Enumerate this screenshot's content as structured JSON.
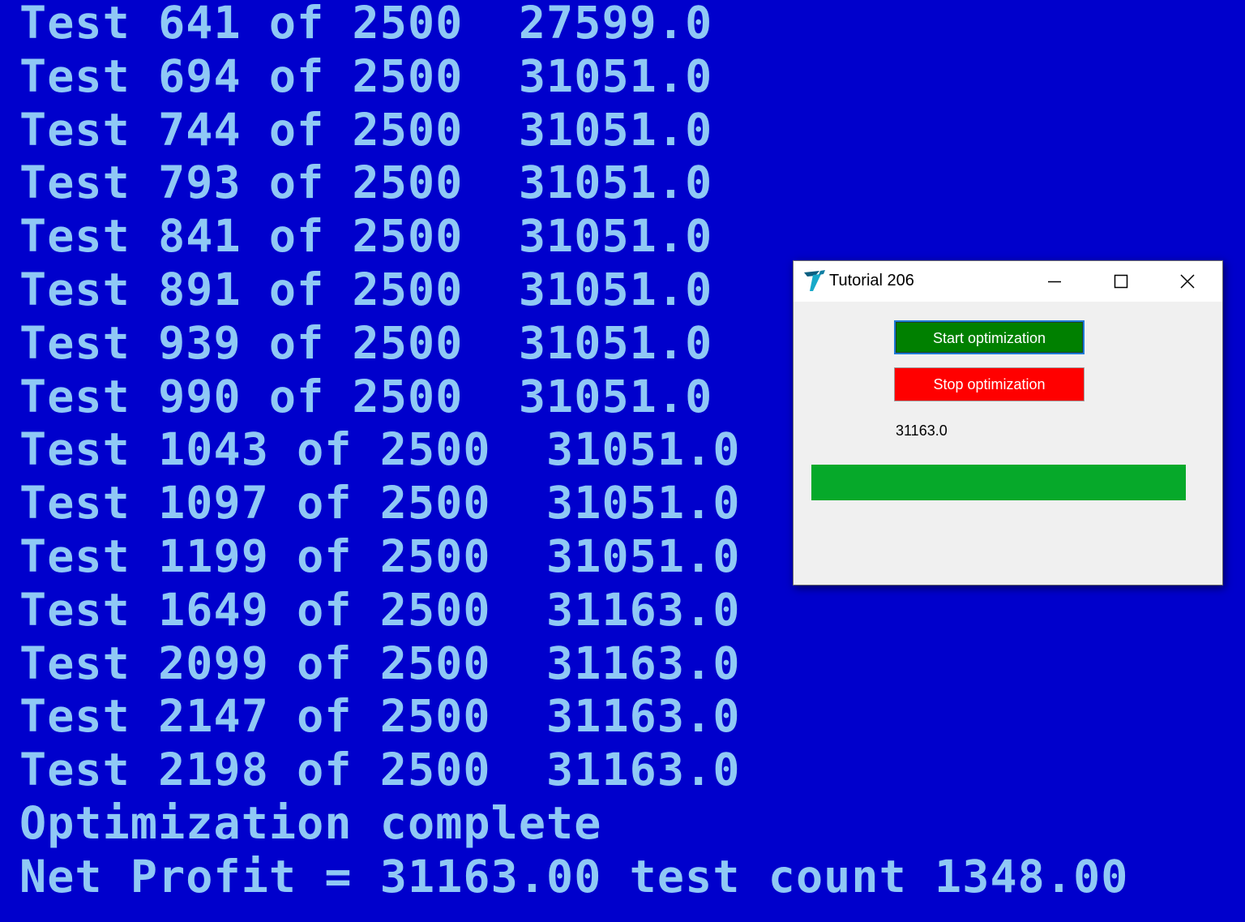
{
  "console": {
    "lines": [
      "Test 641 of 2500  27599.0",
      "Test 694 of 2500  31051.0",
      "Test 744 of 2500  31051.0",
      "Test 793 of 2500  31051.0",
      "Test 841 of 2500  31051.0",
      "Test 891 of 2500  31051.0",
      "Test 939 of 2500  31051.0",
      "Test 990 of 2500  31051.0",
      "Test 1043 of 2500  31051.0",
      "Test 1097 of 2500  31051.0",
      "Test 1199 of 2500  31051.0",
      "Test 1649 of 2500  31163.0",
      "Test 2099 of 2500  31163.0",
      "Test 2147 of 2500  31163.0",
      "Test 2198 of 2500  31163.0",
      "Optimization complete",
      "Net Profit = 31163.00 test count 1348.00"
    ]
  },
  "window": {
    "title": "Tutorial 206",
    "app_icon": "tutorial-logo-icon",
    "controls": [
      "minimize-icon",
      "maximize-icon",
      "close-icon"
    ],
    "start_label": "Start optimization",
    "stop_label": "Stop optimization",
    "result": "31163.0",
    "progress_fraction": 1.0
  },
  "colors": {
    "console_background": "#0000cc",
    "console_text": "#8fc8f5",
    "start_button": "#008000",
    "stop_button": "#ff0000",
    "progress_fill": "#06a92a"
  }
}
